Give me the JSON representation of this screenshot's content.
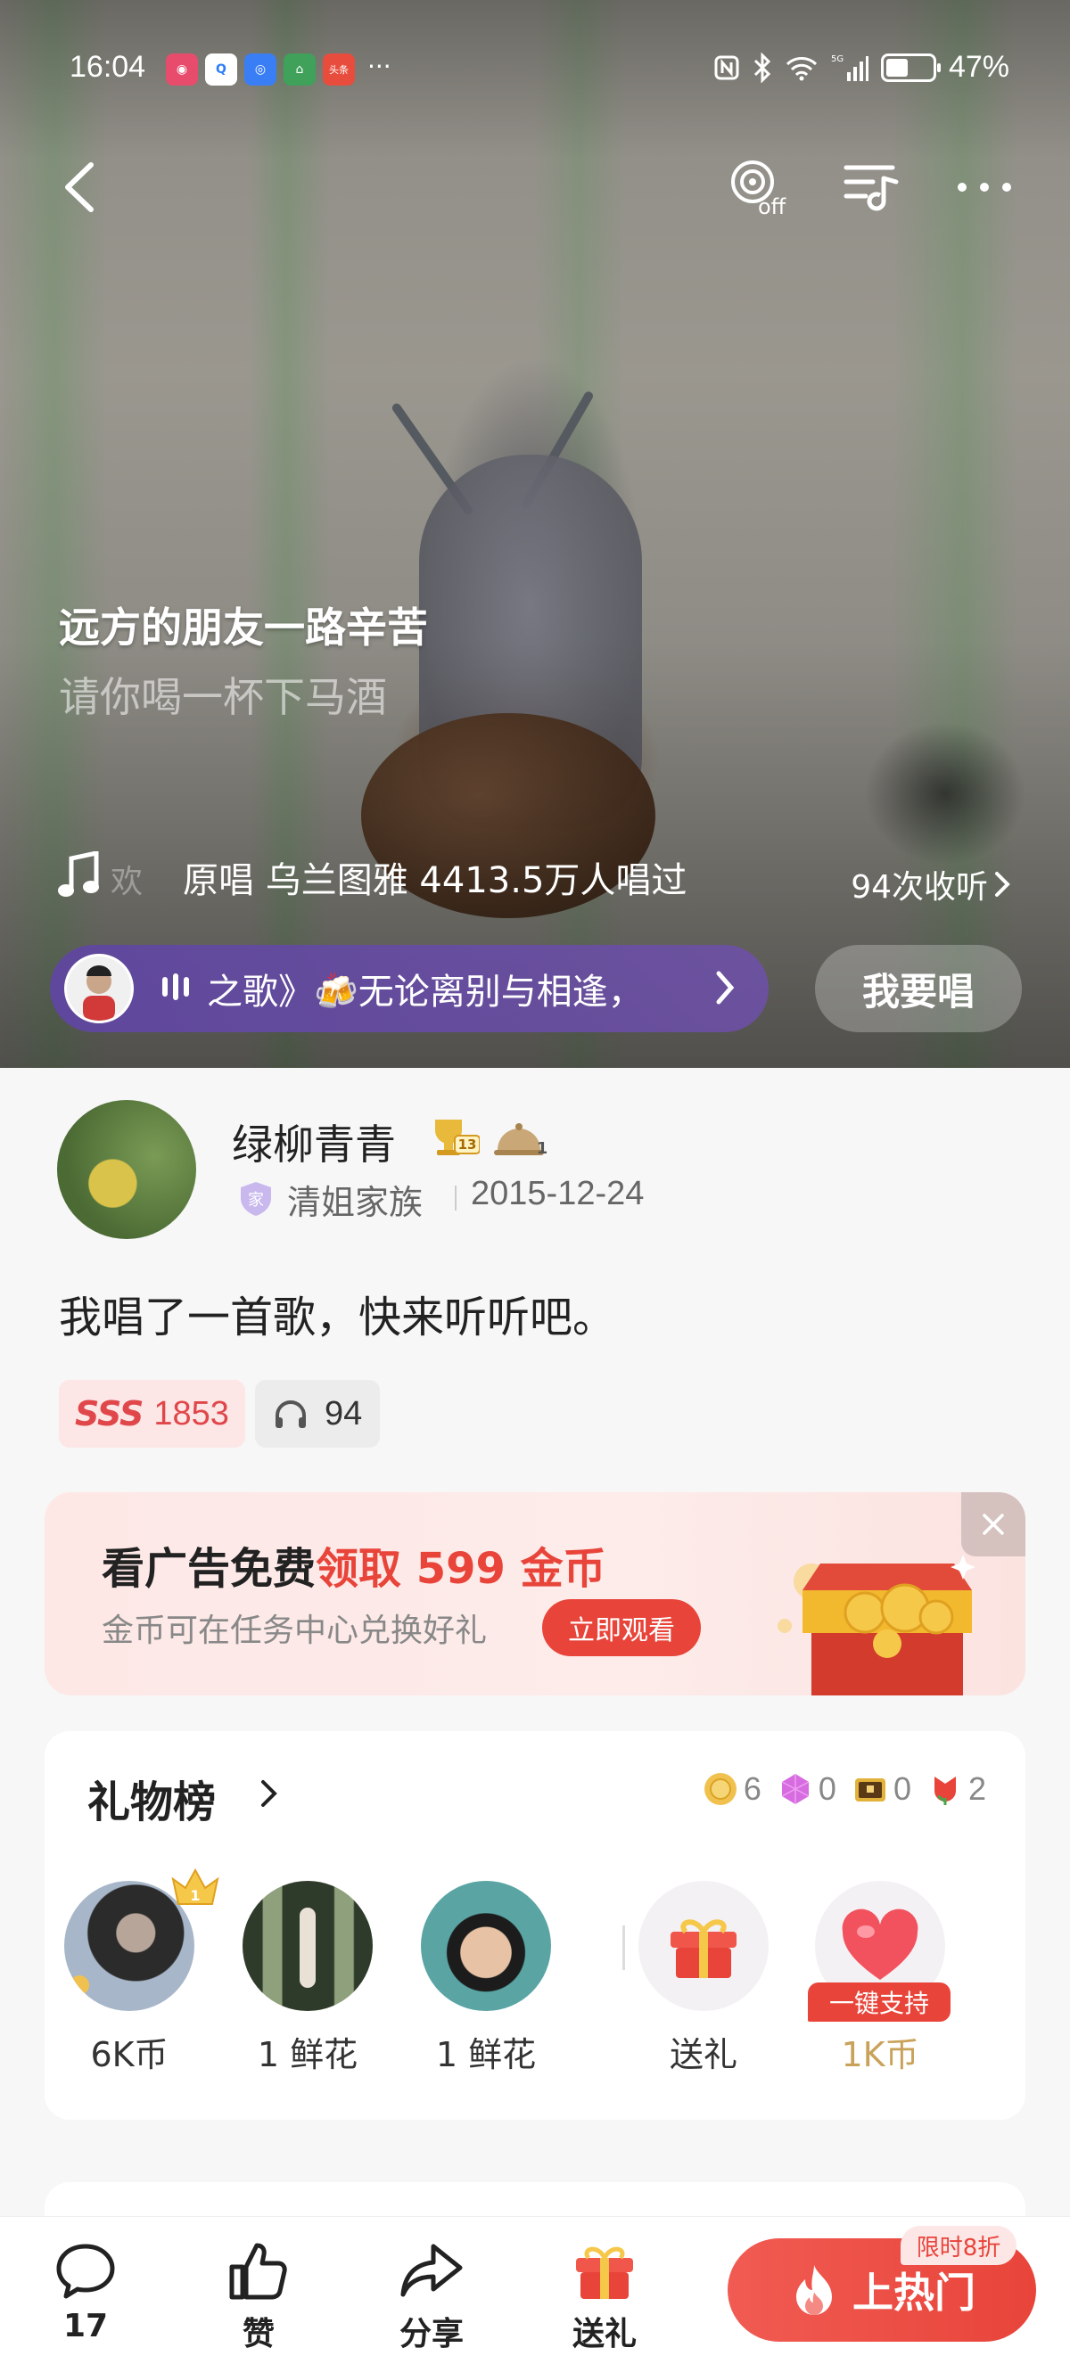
{
  "status_bar": {
    "time": "16:04",
    "app_icons": [
      {
        "name": "bilibili-like-icon",
        "color": "#e84c6d",
        "glyph": "◉"
      },
      {
        "name": "qq-browser-icon",
        "color": "#2d7df6",
        "glyph": "Q"
      },
      {
        "name": "browser-icon",
        "color": "#3a7ef5",
        "glyph": "◎"
      },
      {
        "name": "home-app-icon",
        "color": "#3fa15a",
        "glyph": "⌂"
      },
      {
        "name": "toutiao-icon",
        "color": "#e84c3d",
        "glyph": "头条"
      }
    ],
    "more": "···",
    "battery": "47%"
  },
  "lyrics": {
    "current": "远方的朋友一路辛苦",
    "next": "请你喝一杯下马酒"
  },
  "song": {
    "ghost_char": "欢",
    "info": "原唱 乌兰图雅 4413.5万人唱过",
    "listens": "94次收听"
  },
  "marquee": {
    "text": "之歌》🍻无论离别与相逢，"
  },
  "sing_button": "我要唱",
  "user": {
    "name": "绿柳青青",
    "trophy_level": "13",
    "bell_level": "1",
    "family_badge": "家",
    "family": "清姐家族",
    "date": "2015-12-24"
  },
  "post": {
    "text": "我唱了一首歌，快来听听吧。",
    "score_grade": "SSS",
    "score": "1853",
    "plays": "94"
  },
  "ad": {
    "title_prefix": "看广告免费",
    "title_highlight": "领取 599 金币",
    "subtitle": "金币可在任务中心兑换好礼",
    "button": "立即观看"
  },
  "gift_board": {
    "title": "礼物榜",
    "stats": [
      {
        "icon": "coin-icon",
        "color": "#f1c14f",
        "value": "6"
      },
      {
        "icon": "gem-icon",
        "color": "#d66ce0",
        "value": "0"
      },
      {
        "icon": "chest-icon",
        "color": "#e2b23a",
        "value": "0"
      },
      {
        "icon": "flower-icon",
        "color": "#e8443a",
        "value": "2"
      }
    ],
    "gifters": [
      {
        "label": "6K币",
        "rank": "1"
      },
      {
        "label": "1 鲜花"
      },
      {
        "label": "1 鲜花"
      }
    ],
    "send_gift": "送礼",
    "support_tag": "一键支持",
    "support_value": "1K币"
  },
  "bottom_bar": {
    "comments": "17",
    "like": "赞",
    "share": "分享",
    "gift": "送礼",
    "hot": "上热门",
    "discount": "限时8折"
  },
  "colors": {
    "accent": "#e8443a",
    "purple_pill": "#6a4fa8",
    "gold": "#c9a25a"
  }
}
